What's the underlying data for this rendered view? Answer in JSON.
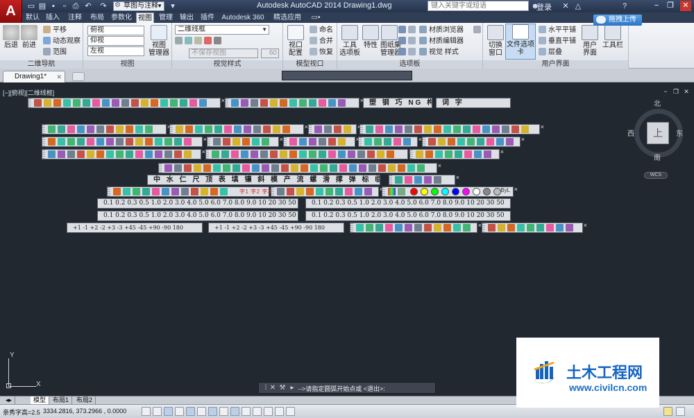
{
  "titlebar": {
    "workspace": "草图与注释",
    "title": "Autodesk AutoCAD 2014    Drawing1.dwg",
    "search_placeholder": "键入关键字或短语",
    "login": "登录",
    "logo_letter": "A"
  },
  "ribbon_tabs": [
    "默认",
    "插入",
    "注释",
    "布局",
    "参数化",
    "视图",
    "管理",
    "输出",
    "插件",
    "Autodesk 360",
    "精选应用"
  ],
  "ribbon_active_tab": "视图",
  "upload_button": "拖拽上传",
  "panels": {
    "nav": {
      "title": "二维导航",
      "back": "后退",
      "forward": "前进",
      "pan": "平移",
      "orbit": "动态观察",
      "extent": "范围"
    },
    "views": {
      "title": "视图",
      "items": [
        "俯视",
        "仰视",
        "左视"
      ],
      "manager": "视图\n管理器"
    },
    "visual_styles": {
      "title": "视觉样式",
      "style": "二维线框",
      "disabled_combo": "不保存视图",
      "number": "60"
    },
    "model_viewports": {
      "title": "模型视口",
      "config": "视口\n配置",
      "items": [
        "命名",
        "合并",
        "恢复"
      ]
    },
    "palettes": {
      "title": "选项板",
      "tool_palettes": "工具\n选项板",
      "properties": "特性",
      "sheet_set": "图纸集\n管理器"
    },
    "materials": {
      "items": [
        "材质浏览器",
        "材质编辑器",
        "视觉 样式"
      ]
    },
    "user_interface": {
      "title": "用户界面",
      "switch_window": "切换\n窗口",
      "file_tabs": "文件选项卡",
      "tile_h": "水平平铺",
      "tile_v": "垂直平铺",
      "cascade": "层叠",
      "ui": "用户\n界面",
      "toolbar": "工具栏"
    }
  },
  "document": {
    "tab": "Drawing1*"
  },
  "viewport_label": "[−][俯视][二维线框]",
  "viewcube": {
    "north": "北",
    "south": "南",
    "east": "东",
    "west": "西",
    "face": "上",
    "wcs": "WCS"
  },
  "toolbars": {
    "text_strip_1": "中 水 仁 尺 顶 表 填 镶 斜 模 产 流 螺 滑 撑 弹 标 临 字",
    "text_strip_2": "塑 钢 巧 NG 构 警",
    "text_strip_3": "词 字",
    "ltscale_1": "0.1  0.2  0.3  0.5  1.0  2.0  3.0  4.0  5.0  6.0  7.0  8.0  9.0  10  20  30  50",
    "ltscale_2": "0.1  0.2  0.3  0.5  1.0  2.0  3.0  4.0  5.0  6.0  7.0  8.0  9.0  10  20  30  50",
    "ltscale_3": "0.1  0.2  0.3  0.5  1.0  2.0  3.0  4.0  5.0  6.0  7.0  8.0  9.0  10  20  30  50",
    "ltscale_4": "0.1  0.2  0.3  0.5  1.0  2.0  3.0  4.0  5.0  6.0  7.0  8.0  9.0  10  20  30  50",
    "rotate_1": "+1  -1  +2  -2  +3  -3  +45  -45  +90  -90  180",
    "rotate_2": "+1  -1  +2  -2  +3  -3  +45  -45  +90  -90  180",
    "layer_labels": "字1 字2 字3",
    "color_bar_end": "ByL"
  },
  "colors": {
    "swatches": [
      "#ff0000",
      "#ffff00",
      "#00ff00",
      "#00ffff",
      "#0000ff",
      "#ff00ff",
      "#ffffff",
      "#888888",
      "#bbbbbb"
    ]
  },
  "ucs": {
    "y": "Y",
    "x": "X"
  },
  "command_line": {
    "text": "·->请指定圆弧开始点或 <退出>:"
  },
  "watermark": {
    "title": "土木工程网",
    "url": "www.civilcn.com"
  },
  "layout_tabs": [
    "模型",
    "布局1",
    "布局2"
  ],
  "statusbar": {
    "prompt": "亲秀字高=2.5",
    "coords": "3334.2816,  373.2966 ,  0.0000"
  }
}
